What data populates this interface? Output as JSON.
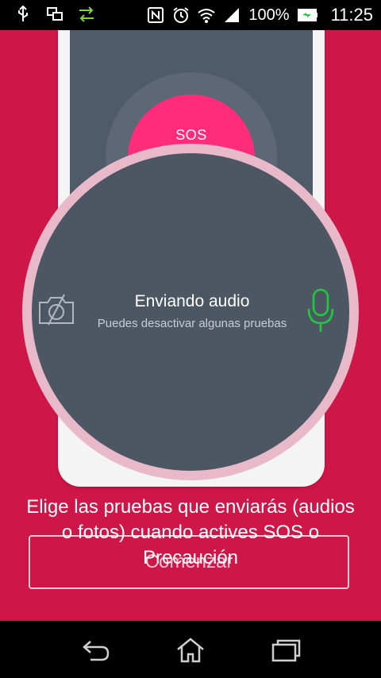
{
  "status_bar": {
    "battery_percent": "100%",
    "time": "11:25",
    "left_icons": [
      "usb-icon",
      "screens-icon",
      "data-transfer-icon"
    ],
    "right_icons": [
      "nfc-icon",
      "alarm-icon",
      "wifi-icon",
      "signal-icon",
      "battery-icon"
    ]
  },
  "phone_mockup": {
    "sos_label": "SOS"
  },
  "circle": {
    "title": "Enviando audio",
    "subtitle": "Puedes desactivar algunas pruebas",
    "left_icon": "camera-off-icon",
    "right_icon": "microphone-icon"
  },
  "description": "Elige las pruebas que enviarás (audios o fotos) cuando actives SOS o Precaución",
  "start_button_label": "Comenzar",
  "nav_bar": {
    "icons": [
      "back-icon",
      "home-icon",
      "recent-apps-icon"
    ]
  },
  "colors": {
    "background": "#cf1648",
    "sos": "#ff2d79",
    "circle": "#4d5764",
    "mic": "#1ecb3a"
  }
}
